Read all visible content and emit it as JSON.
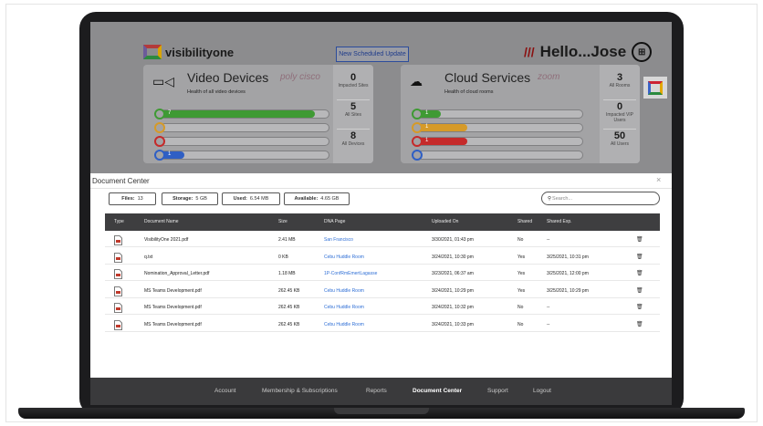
{
  "app": {
    "brand": "visibilityone"
  },
  "header": {
    "scheduled_update": "New Scheduled Update",
    "greeting": "Hello...Jose"
  },
  "video_panel": {
    "title": "Video Devices",
    "subtitle": "Health of all video devices",
    "brand": "poly cisco",
    "bars": [
      {
        "count": "7",
        "color": "#3f9a34",
        "fill": 0.92
      },
      {
        "count": "",
        "color": "#d69a28",
        "fill": 0
      },
      {
        "count": "",
        "color": "#c52a2a",
        "fill": 0
      },
      {
        "count": "1",
        "color": "#2f5fc4",
        "fill": 0.14
      }
    ],
    "stats": [
      {
        "value": "0",
        "label": "Impacted Sites"
      },
      {
        "value": "5",
        "label": "All Sites"
      },
      {
        "value": "8",
        "label": "All Devices"
      }
    ]
  },
  "cloud_panel": {
    "title": "Cloud Services",
    "subtitle": "Health of cloud rooms",
    "brand": "zoom",
    "bars": [
      {
        "count": "1",
        "color": "#3f9a34",
        "fill": 0.14
      },
      {
        "count": "1",
        "color": "#d69a28",
        "fill": 0.3
      },
      {
        "count": "1",
        "color": "#c52a2a",
        "fill": 0.3
      },
      {
        "count": "",
        "color": "#2f5fc4",
        "fill": 0
      }
    ],
    "stats": [
      {
        "value": "3",
        "label": "All Rooms"
      },
      {
        "value": "0",
        "label": "Impacted VIP Users"
      },
      {
        "value": "50",
        "label": "All Users"
      }
    ]
  },
  "document_center": {
    "title": "Document Center",
    "close": "×",
    "files_label": "Files:",
    "files_value": "13",
    "storage_label": "Storage:",
    "storage_value": "5 GB",
    "used_label": "Used:",
    "used_value": "6.54 MB",
    "available_label": "Available:",
    "available_value": "4.65 GB",
    "search_placeholder": "Search...",
    "columns": [
      "Type",
      "Document Name",
      "Size",
      "DNA Page",
      "Uploaded On",
      "Shared",
      "Shared Exp."
    ],
    "rows": [
      {
        "name": "VisibilityOne 2021.pdf",
        "size": "2.41 MB",
        "dna": "San Francisco",
        "uploaded": "3/30/2021, 01:43 pm",
        "shared": "No",
        "exp": "--"
      },
      {
        "name": "q.txt",
        "size": "0 KB",
        "dna": "Cebu Huddle Room",
        "uploaded": "3/24/2021, 10:30 pm",
        "shared": "Yes",
        "exp": "3/25/2021, 10:31 pm"
      },
      {
        "name": "Nomination_Approval_Letter.pdf",
        "size": "1.18 MB",
        "dna": "1P-ConfRmEmertLagasse",
        "uploaded": "3/23/2021, 06:37 am",
        "shared": "Yes",
        "exp": "3/25/2021, 12:00 pm"
      },
      {
        "name": "MS Teams Development.pdf",
        "size": "262.45 KB",
        "dna": "Cebu Huddle Room",
        "uploaded": "3/24/2021, 10:29 pm",
        "shared": "Yes",
        "exp": "3/25/2021, 10:29 pm"
      },
      {
        "name": "MS Teams Development.pdf",
        "size": "262.45 KB",
        "dna": "Cebu Huddle Room",
        "uploaded": "3/24/2021, 10:32 pm",
        "shared": "No",
        "exp": "--"
      },
      {
        "name": "MS Teams Development.pdf",
        "size": "262.45 KB",
        "dna": "Cebu Huddle Room",
        "uploaded": "3/24/2021, 10:33 pm",
        "shared": "No",
        "exp": "--"
      }
    ]
  },
  "footer": {
    "items": [
      "Account",
      "Membership & Subscriptions",
      "Reports",
      "Document Center",
      "Support",
      "Logout"
    ],
    "active": "Document Center"
  }
}
